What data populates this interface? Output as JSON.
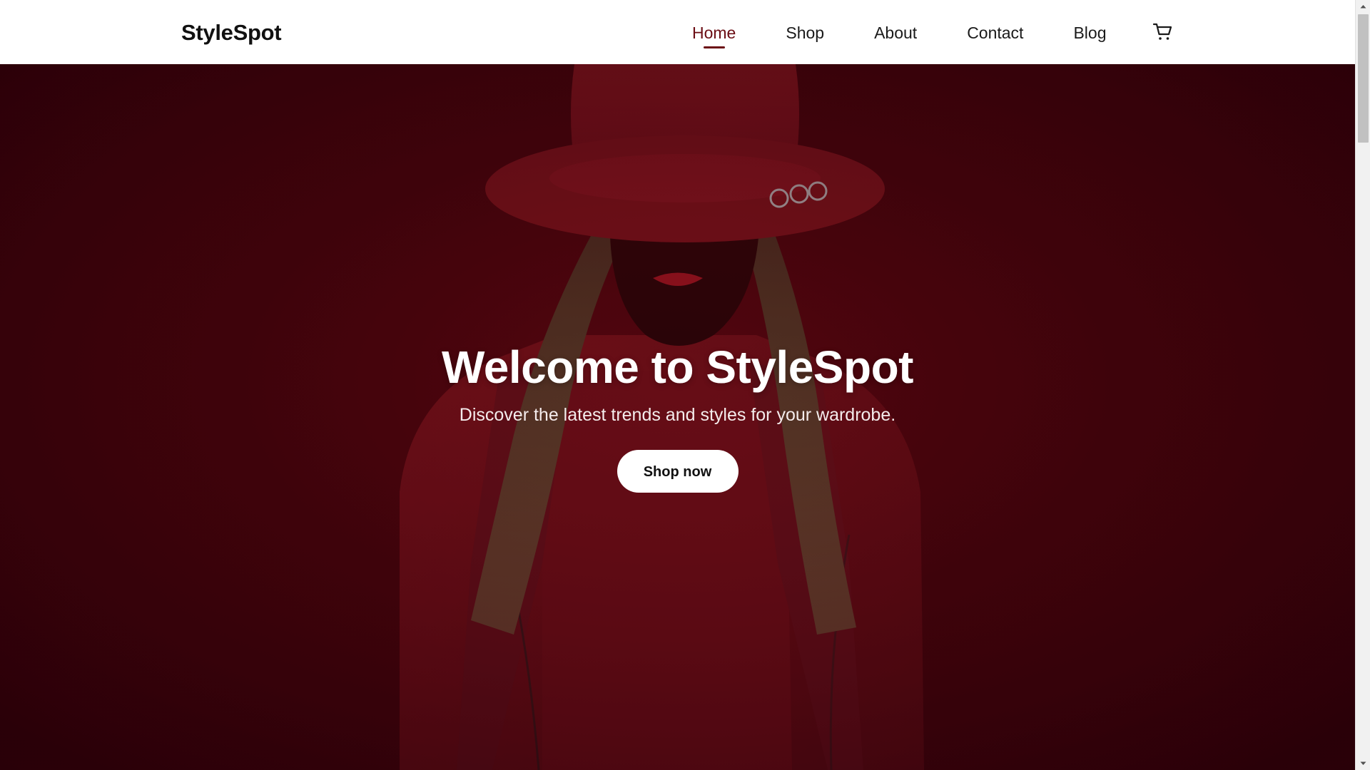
{
  "brand": {
    "name": "StyleSpot"
  },
  "nav": {
    "items": [
      {
        "label": "Home",
        "active": true
      },
      {
        "label": "Shop",
        "active": false
      },
      {
        "label": "About",
        "active": false
      },
      {
        "label": "Contact",
        "active": false
      },
      {
        "label": "Blog",
        "active": false
      }
    ],
    "cart_icon": "shopping-cart-icon"
  },
  "hero": {
    "title": "Welcome to StyleSpot",
    "subtitle": "Discover the latest trends and styles for your wardrobe.",
    "cta_label": "Shop now",
    "image_subject": "woman-in-red-hat-and-red-leather-jacket"
  },
  "colors": {
    "accent": "#6b0d14",
    "hero_background": "#44040b",
    "nav_background": "#ffffff",
    "cta_background": "#ffffff"
  }
}
